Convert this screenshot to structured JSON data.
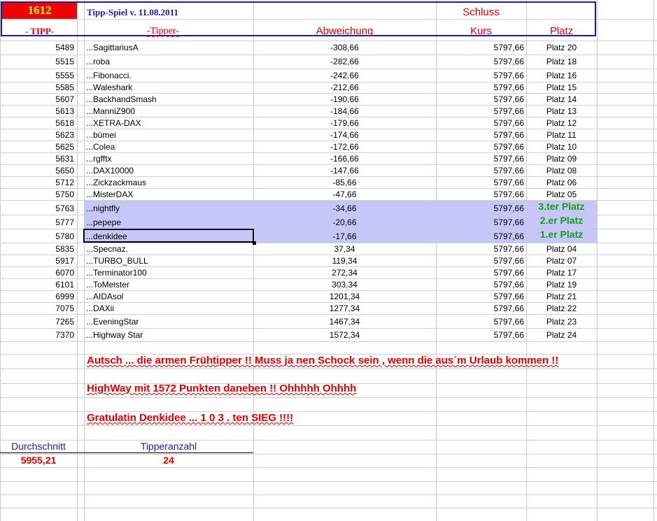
{
  "header": {
    "badge": "1612",
    "title": "Tipp-Spiel v. 11.08.2011",
    "schluss": "Schluss",
    "col_tipp": "- TIPP-",
    "col_tipper": "-Tipper-",
    "col_abweichung": "Abweichung",
    "col_kurs": "Kurs",
    "col_platz": "Platz"
  },
  "rows": [
    {
      "tipp": "5489",
      "tipper": "...SagittariusA",
      "abw": "-308,66",
      "kurs": "5797,66",
      "platz": "Platz 20"
    },
    {
      "tipp": "5515",
      "tipper": "...roba",
      "abw": "-282,66",
      "kurs": "5797,66",
      "platz": "Platz 18"
    },
    {
      "tipp": "5555",
      "tipper": "...Fibonacci.",
      "abw": "-242,66",
      "kurs": "5797,66",
      "platz": "Platz 16"
    },
    {
      "tipp": "5585",
      "tipper": "...Waleshark",
      "abw": "-212,66",
      "kurs": "5797,66",
      "platz": "Platz 15"
    },
    {
      "tipp": "5607",
      "tipper": "...BackhandSmash",
      "abw": "-190,66",
      "kurs": "5797,66",
      "platz": "Platz 14"
    },
    {
      "tipp": "5613",
      "tipper": "...ManniZ900",
      "abw": "-184,66",
      "kurs": "5797,66",
      "platz": "Platz 13"
    },
    {
      "tipp": "5618",
      "tipper": "...XETRA-DAX",
      "abw": "-179,66",
      "kurs": "5797,66",
      "platz": "Platz 12"
    },
    {
      "tipp": "5623",
      "tipper": "...bümei",
      "abw": "-174,66",
      "kurs": "5797,66",
      "platz": "Platz 11"
    },
    {
      "tipp": "5625",
      "tipper": "...Colea",
      "abw": "-172,66",
      "kurs": "5797,66",
      "platz": "Platz 10"
    },
    {
      "tipp": "5631",
      "tipper": "...rgfftx",
      "abw": "-166,66",
      "kurs": "5797,66",
      "platz": "Platz 09"
    },
    {
      "tipp": "5650",
      "tipper": "...DAX10000",
      "abw": "-147,66",
      "kurs": "5797,66",
      "platz": "Platz 08"
    },
    {
      "tipp": "5712",
      "tipper": "...Zickzackmaus",
      "abw": "-85,66",
      "kurs": "5797,66",
      "platz": "Platz 06"
    },
    {
      "tipp": "5750",
      "tipper": "...MisterDAX",
      "abw": "-47,66",
      "kurs": "5797,66",
      "platz": "Platz 05"
    },
    {
      "tipp": "5763",
      "tipper": "...nightfly",
      "abw": "-34,66",
      "kurs": "5797,66",
      "platz": "3.ter Platz"
    },
    {
      "tipp": "5777",
      "tipper": "...pepepe",
      "abw": "-20,66",
      "kurs": "5797,66",
      "platz": "2.er Platz"
    },
    {
      "tipp": "5780",
      "tipper": "...denkidee",
      "abw": "-17,66",
      "kurs": "5797,66",
      "platz": "1.er Platz"
    },
    {
      "tipp": "5835",
      "tipper": "...Specnaz.",
      "abw": "37,34",
      "kurs": "5797,66",
      "platz": "Platz 04"
    },
    {
      "tipp": "5917",
      "tipper": "...TURBO_BULL",
      "abw": "119,34",
      "kurs": "5797,66",
      "platz": "Platz 07"
    },
    {
      "tipp": "6070",
      "tipper": "...Terminator100",
      "abw": "272,34",
      "kurs": "5797,66",
      "platz": "Platz 17"
    },
    {
      "tipp": "6101",
      "tipper": "...ToMeister",
      "abw": "303,34",
      "kurs": "5797,66",
      "platz": "Platz 19"
    },
    {
      "tipp": "6999",
      "tipper": "...AIDAsol",
      "abw": "1201,34",
      "kurs": "5797,66",
      "platz": "Platz 21"
    },
    {
      "tipp": "7075",
      "tipper": "...DAXii",
      "abw": "1277,34",
      "kurs": "5797,66",
      "platz": "Platz 22"
    },
    {
      "tipp": "7265",
      "tipper": "...EveningStar",
      "abw": "1467,34",
      "kurs": "5797,66",
      "platz": "Platz 23"
    },
    {
      "tipp": "7370",
      "tipper": "...Highway Star",
      "abw": "1572,34",
      "kurs": "5797,66",
      "platz": "Platz 24"
    }
  ],
  "messages": [
    "Autsch ... die armen Frühtipper !!  Muss ja nen Schock sein , wenn die aus´m Urlaub kommen !!",
    "HighWay mit 1572 Punkten daneben !! Ohhhhh    Ohhhh",
    "Gratulatin Denkidee ... 1 0 3 . ten SIEG !!!!"
  ],
  "summary": {
    "durchschnitt_label": "Durchschnitt",
    "durchschnitt_value": "5955,21",
    "tipperanzahl_label": "Tipperanzahl",
    "tipperanzahl_value": "24"
  },
  "colors": {
    "accent_red": "#e00000",
    "header_blue": "#1c1ca8",
    "highlight": "#c6c6f8",
    "winner_green": "#14a014"
  }
}
